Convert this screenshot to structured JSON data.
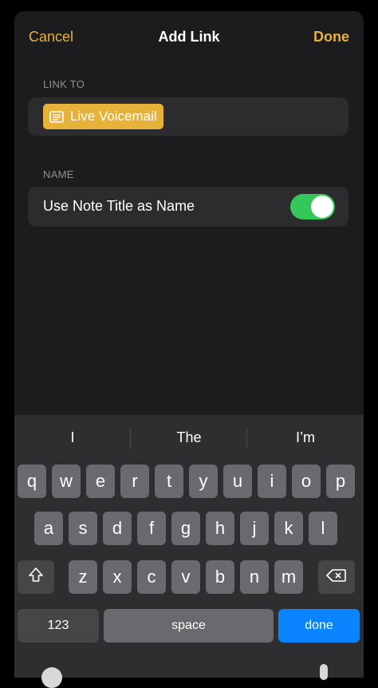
{
  "nav": {
    "cancel": "Cancel",
    "title": "Add Link",
    "done": "Done"
  },
  "link_section": {
    "header": "LINK TO",
    "chip_label": "Live Voicemail"
  },
  "name_section": {
    "header": "NAME",
    "toggle_label": "Use Note Title as Name",
    "toggle_on": true
  },
  "keyboard": {
    "suggestions": [
      "I",
      "The",
      "I’m"
    ],
    "row1": [
      "q",
      "w",
      "e",
      "r",
      "t",
      "y",
      "u",
      "i",
      "o",
      "p"
    ],
    "row2": [
      "a",
      "s",
      "d",
      "f",
      "g",
      "h",
      "j",
      "k",
      "l"
    ],
    "row3": [
      "z",
      "x",
      "c",
      "v",
      "b",
      "n",
      "m"
    ],
    "numbers_key": "123",
    "space_key": "space",
    "return_key": "done"
  },
  "colors": {
    "accent": "#e6b23a",
    "toggle_on": "#34c759",
    "return_key": "#0a84ff"
  }
}
